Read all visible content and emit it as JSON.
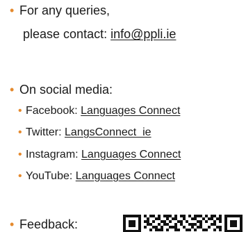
{
  "contact": {
    "line1": "For any queries,",
    "line2_prefix": "please contact: ",
    "email": "info@ppli.ie"
  },
  "social": {
    "heading": "On social media:",
    "items": [
      {
        "label": "Facebook: ",
        "link": "Languages Connect"
      },
      {
        "label": "Twitter: ",
        "link": "LangsConnect_ie"
      },
      {
        "label": "Instagram: ",
        "link": "Languages Connect"
      },
      {
        "label": "YouTube: ",
        "link": "Languages Connect"
      }
    ]
  },
  "feedback": {
    "label": "Feedback:"
  },
  "colors": {
    "bullet": "#e58a2e",
    "text": "#1a1a1a"
  }
}
